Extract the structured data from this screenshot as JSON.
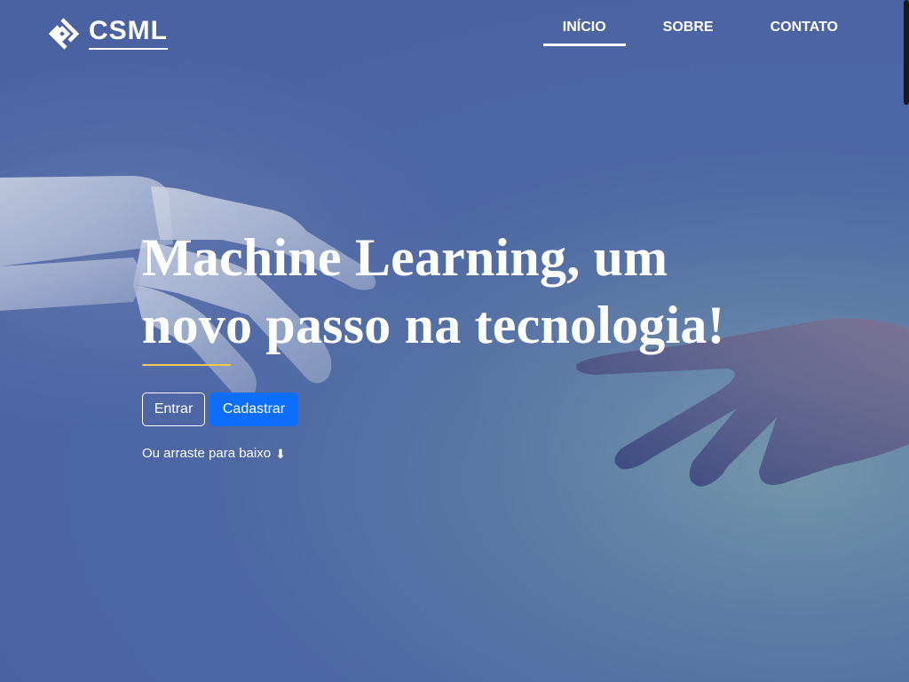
{
  "brand": {
    "name": "CSML"
  },
  "nav": {
    "items": [
      {
        "label": "INÍCIO",
        "active": true
      },
      {
        "label": "SOBRE",
        "active": false
      },
      {
        "label": "CONTATO",
        "active": false
      }
    ]
  },
  "hero": {
    "headline_line1": "Machine Learning, um",
    "headline_line2": "novo passo na tecnologia!",
    "buttons": {
      "login_label": "Entrar",
      "signup_label": "Cadastrar"
    },
    "scroll_hint": "Ou arraste para baixo",
    "scroll_hint_icon": "⬇"
  },
  "colors": {
    "background": "#4d66a4",
    "accent_line": "#f2c94c",
    "primary_button": "#0d6efd",
    "text": "#ffffff"
  },
  "icons": {
    "logo": "diamond-chain-logo-icon",
    "scroll": "down-arrow-icon"
  }
}
